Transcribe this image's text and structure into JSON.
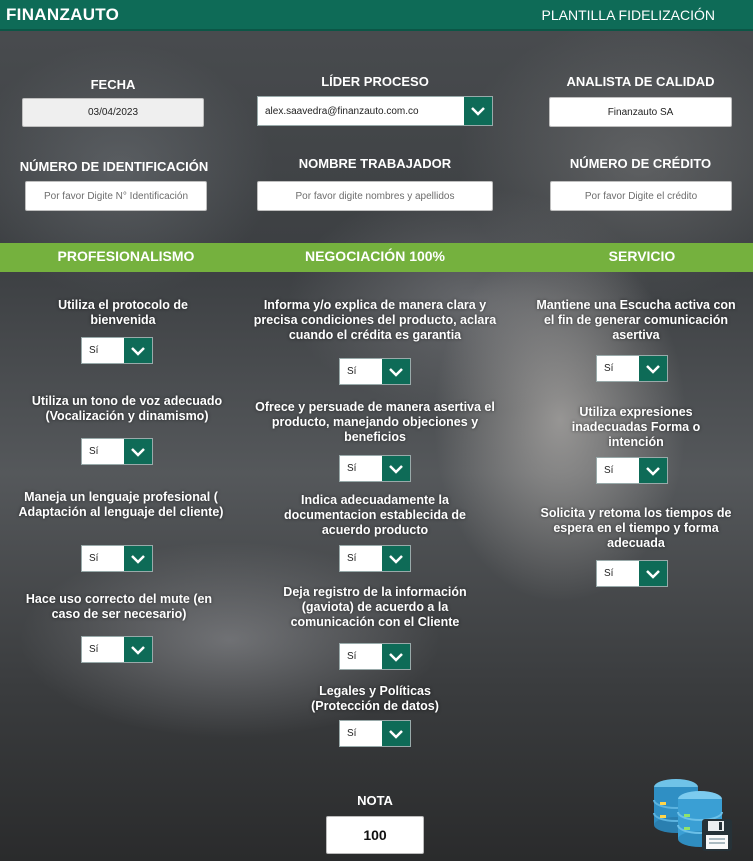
{
  "header": {
    "brand": "FINANZAUTO",
    "template_title": "PLANTILLA FIDELIZACIÓN"
  },
  "fields": {
    "fecha": {
      "label": "FECHA",
      "value": "03/04/2023"
    },
    "lider": {
      "label": "LÍDER PROCESO",
      "value": "alex.saavedra@finanzauto.com.co"
    },
    "analista": {
      "label": "ANALISTA DE CALIDAD",
      "value": "Finanzauto SA"
    },
    "identificacion": {
      "label": "NÚMERO DE IDENTIFICACIÓN",
      "placeholder": "Por favor Digite N° Identificación"
    },
    "nombre": {
      "label": "NOMBRE TRABAJADOR",
      "placeholder": "Por favor digite nombres y apellidos"
    },
    "credito": {
      "label": "NÚMERO DE CRÉDITO",
      "placeholder": "Por favor Digite el crédito"
    }
  },
  "sections": {
    "profesionalismo": {
      "title": "PROFESIONALISMO",
      "questions": [
        {
          "text": "Utiliza el protocolo de bienvenida",
          "answer": "Sí"
        },
        {
          "text": "Utiliza un tono de voz adecuado (Vocalización y dinamismo)",
          "answer": "Sí"
        },
        {
          "text": "Maneja un lenguaje profesional ( Adaptación al lenguaje del cliente)",
          "answer": "Sí"
        },
        {
          "text": "Hace uso correcto del mute (en caso de ser necesario)",
          "answer": "Sí"
        }
      ]
    },
    "negociacion": {
      "title": "NEGOCIACIÓN 100%",
      "questions": [
        {
          "text": "Informa y/o explica de manera clara y precisa condiciones del producto, aclara cuando el crédita es garantia",
          "answer": "Sí"
        },
        {
          "text": "Ofrece y persuade de manera asertiva el producto, manejando objeciones y beneficios",
          "answer": "Sí"
        },
        {
          "text": "Indica adecuadamente la documentacion establecida de acuerdo producto",
          "answer": "Sí"
        },
        {
          "text": "Deja registro de la información (gaviota) de acuerdo a la comunicación con el Cliente",
          "answer": "Sí"
        },
        {
          "text": "Legales y Políticas (Protección de datos)",
          "answer": "Sí"
        }
      ]
    },
    "servicio": {
      "title": "SERVICIO",
      "questions": [
        {
          "text": "Mantiene una Escucha activa con el fin de generar comunicación asertiva",
          "answer": "Sí"
        },
        {
          "text": "Utiliza expresiones inadecuadas Forma o intención",
          "answer": "Sí"
        },
        {
          "text": "Solicita y retoma los tiempos de espera en el tiempo y forma adecuada",
          "answer": "Sí"
        }
      ]
    }
  },
  "nota": {
    "label": "NOTA",
    "value": "100"
  },
  "icons": {
    "dropdown": "chevron-down-icon",
    "save": "database-save-icon"
  },
  "colors": {
    "brand_green": "#0e6b57",
    "band_green": "#75b13e"
  }
}
